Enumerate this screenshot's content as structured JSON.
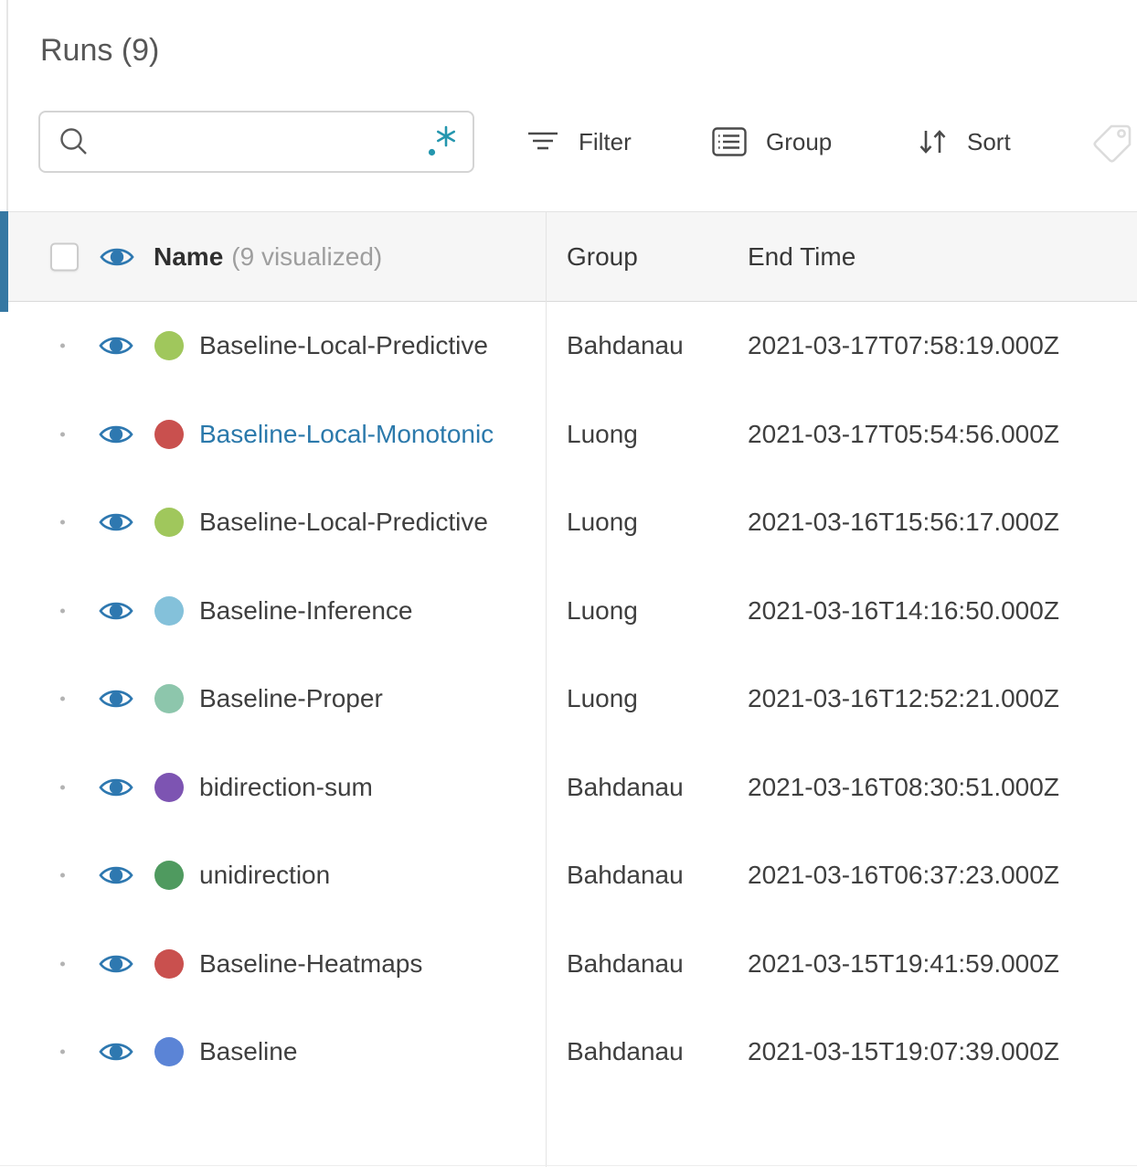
{
  "panel": {
    "title": "Runs (9)"
  },
  "search": {
    "value": "",
    "placeholder": ""
  },
  "toolbar": {
    "filter_label": "Filter",
    "group_label": "Group",
    "sort_label": "Sort"
  },
  "icons": {
    "search": "magnifier-icon",
    "regex": "dot-asterisk-regex-icon",
    "filter": "funnel-lines-icon",
    "group": "list-box-icon",
    "sort": "arrows-down-up-icon",
    "tag": "tag-outline-icon",
    "visibility": "eye-icon",
    "drag": "dot-handle"
  },
  "colors": {
    "accent_bar": "#3678a3",
    "eye_blue": "#2e78b0",
    "link_blue": "#2b79ab",
    "regex_teal": "#2496ae",
    "header_bg": "#f6f6f6"
  },
  "table": {
    "columns": {
      "name": "Name",
      "visualized_count": "(9 visualized)",
      "group": "Group",
      "end_time": "End Time"
    },
    "rows": [
      {
        "name": "Baseline-Local-Predictive",
        "group": "Bahdanau",
        "end_time": "2021-03-17T07:58:19.000Z",
        "color": "#a0c75c",
        "highlighted": false
      },
      {
        "name": "Baseline-Local-Monotonic",
        "group": "Luong",
        "end_time": "2021-03-17T05:54:56.000Z",
        "color": "#c9504e",
        "highlighted": true
      },
      {
        "name": "Baseline-Local-Predictive",
        "group": "Luong",
        "end_time": "2021-03-16T15:56:17.000Z",
        "color": "#a0c75c",
        "highlighted": false
      },
      {
        "name": "Baseline-Inference",
        "group": "Luong",
        "end_time": "2021-03-16T14:16:50.000Z",
        "color": "#84c1da",
        "highlighted": false
      },
      {
        "name": "Baseline-Proper",
        "group": "Luong",
        "end_time": "2021-03-16T12:52:21.000Z",
        "color": "#8dc6ac",
        "highlighted": false
      },
      {
        "name": "bidirection-sum",
        "group": "Bahdanau",
        "end_time": "2021-03-16T08:30:51.000Z",
        "color": "#7d54b2",
        "highlighted": false
      },
      {
        "name": "unidirection",
        "group": "Bahdanau",
        "end_time": "2021-03-16T06:37:23.000Z",
        "color": "#4f9a5f",
        "highlighted": false
      },
      {
        "name": "Baseline-Heatmaps",
        "group": "Bahdanau",
        "end_time": "2021-03-15T19:41:59.000Z",
        "color": "#c9504e",
        "highlighted": false
      },
      {
        "name": "Baseline",
        "group": "Bahdanau",
        "end_time": "2021-03-15T19:07:39.000Z",
        "color": "#5b84d6",
        "highlighted": false
      }
    ]
  }
}
